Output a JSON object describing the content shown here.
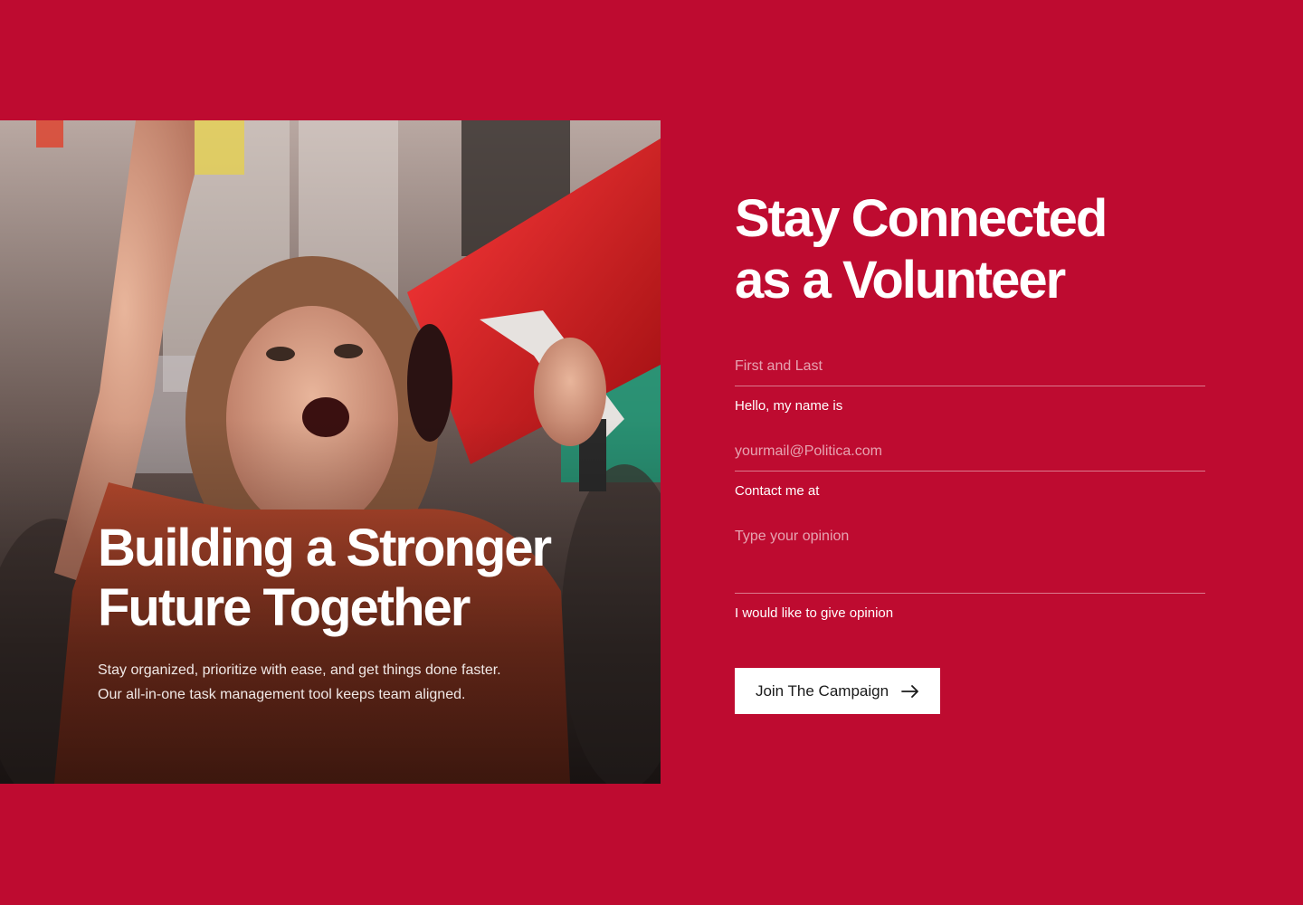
{
  "hero": {
    "title_line1": "Building a Stronger",
    "title_line2": "Future Together",
    "subtitle_line1": "Stay organized, prioritize with ease, and get things done faster.",
    "subtitle_line2": "Our all-in-one task management tool keeps team aligned."
  },
  "form": {
    "title_line1": "Stay Connected",
    "title_line2": "as a Volunteer",
    "fields": [
      {
        "placeholder": "First and Last",
        "label": "Hello, my name is"
      },
      {
        "placeholder": "yourmail@Politica.com",
        "label": "Contact me at"
      },
      {
        "placeholder": "Type your opinion",
        "label": "I would like to give opinion"
      }
    ],
    "submit_label": "Join The Campaign",
    "submit_icon": "arrow-right-icon"
  },
  "colors": {
    "background": "#be0b30",
    "button_bg": "#ffffff",
    "button_text": "#1a1a1a"
  }
}
